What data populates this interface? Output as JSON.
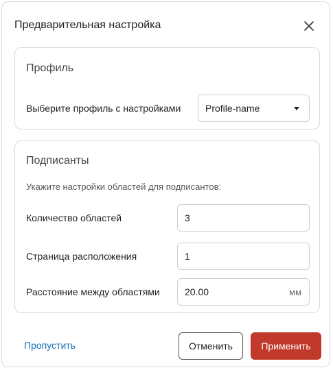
{
  "dialog": {
    "title": "Предварительная настройка",
    "close_icon": "close-icon"
  },
  "profile": {
    "heading": "Профиль",
    "label": "Выберите профиль с настройками",
    "selected": "Profile-name"
  },
  "signers": {
    "heading": "Подписанты",
    "hint": "Укажите настройки областей для подписантов:",
    "areas_label": "Количество областей",
    "areas_value": "3",
    "page_label": "Страница расположения",
    "page_value": "1",
    "distance_label": "Расстояние между областями",
    "distance_value": "20.00",
    "distance_unit": "мм"
  },
  "footer": {
    "skip": "Пропустить",
    "cancel": "Отменить",
    "apply": "Применить"
  },
  "colors": {
    "accent": "#c0392b",
    "link": "#1a73b8"
  }
}
